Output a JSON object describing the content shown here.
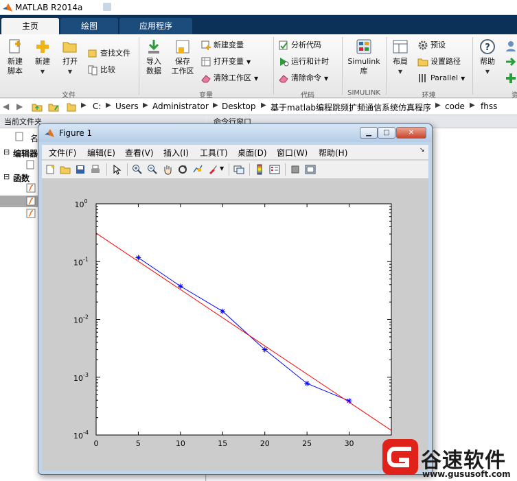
{
  "app": {
    "title": "MATLAB R2014a"
  },
  "ribbon_tabs": [
    "主页",
    "绘图",
    "应用程序"
  ],
  "ribbon": {
    "file": {
      "group_label": "文件",
      "new_script": [
        "新建",
        "脚本"
      ],
      "new": "新建",
      "open": "打开",
      "find_files": "查找文件",
      "compare": "比较"
    },
    "variable": {
      "group_label": "变量",
      "import_data": [
        "导入",
        "数据"
      ],
      "save_workspace": [
        "保存",
        "工作区"
      ],
      "new_variable": "新建变量",
      "open_variable": "打开变量",
      "clear_workspace": "清除工作区"
    },
    "code": {
      "group_label": "代码",
      "analyze_code": "分析代码",
      "run_and_time": "运行和计时",
      "clear_commands": "清除命令"
    },
    "simulink": {
      "group_label": "SIMULINK",
      "library": [
        "Simulink",
        "库"
      ]
    },
    "environment": {
      "group_label": "环境",
      "layout": "布局",
      "preferences": "预设",
      "set_path": "设置路径",
      "parallel": "Parallel"
    },
    "resources": {
      "help": "帮助",
      "group_label_partial": "资"
    }
  },
  "address_bar": {
    "path": [
      "C:",
      "Users",
      "Administrator",
      "Desktop",
      "基于matlab编程跳频扩频通信系统仿真程序",
      "code",
      "fhss"
    ]
  },
  "left_pane": {
    "header": "当前文件夹",
    "col_partial": "名",
    "section_editor": "编辑器",
    "section_functions": "函数"
  },
  "right_pane": {
    "header": "命令行窗口"
  },
  "figure": {
    "title": "Figure 1",
    "menu": [
      "文件(F)",
      "编辑(E)",
      "查看(V)",
      "插入(I)",
      "工具(T)",
      "桌面(D)",
      "窗口(W)",
      "帮助(H)"
    ]
  },
  "chart_data": {
    "type": "line",
    "title": "",
    "xlabel": "",
    "ylabel": "",
    "xlim": [
      0,
      35
    ],
    "ylim": [
      0.0001,
      1
    ],
    "yscale": "log",
    "grid": false,
    "x_ticks": [
      0,
      5,
      10,
      15,
      20,
      25,
      30,
      35
    ],
    "y_ticks": [
      {
        "value": 1,
        "base": "10",
        "exp": "0"
      },
      {
        "value": 0.1,
        "base": "10",
        "exp": "-1"
      },
      {
        "value": 0.01,
        "base": "10",
        "exp": "-2"
      },
      {
        "value": 0.001,
        "base": "10",
        "exp": "-3"
      },
      {
        "value": 0.0001,
        "base": "10",
        "exp": "-4"
      }
    ],
    "series": [
      {
        "color": "#0000ff",
        "marker": "*",
        "x": [
          5,
          10,
          15,
          20,
          25,
          30
        ],
        "y": [
          0.117,
          0.0375,
          0.0138,
          0.003,
          0.00078,
          0.00039
        ]
      },
      {
        "color": "#ff0000",
        "marker": "none",
        "x": [
          0,
          35
        ],
        "y": [
          0.31,
          0.00012
        ]
      }
    ]
  },
  "watermark": {
    "text": "谷速软件",
    "url": "www.gususoft.com"
  }
}
